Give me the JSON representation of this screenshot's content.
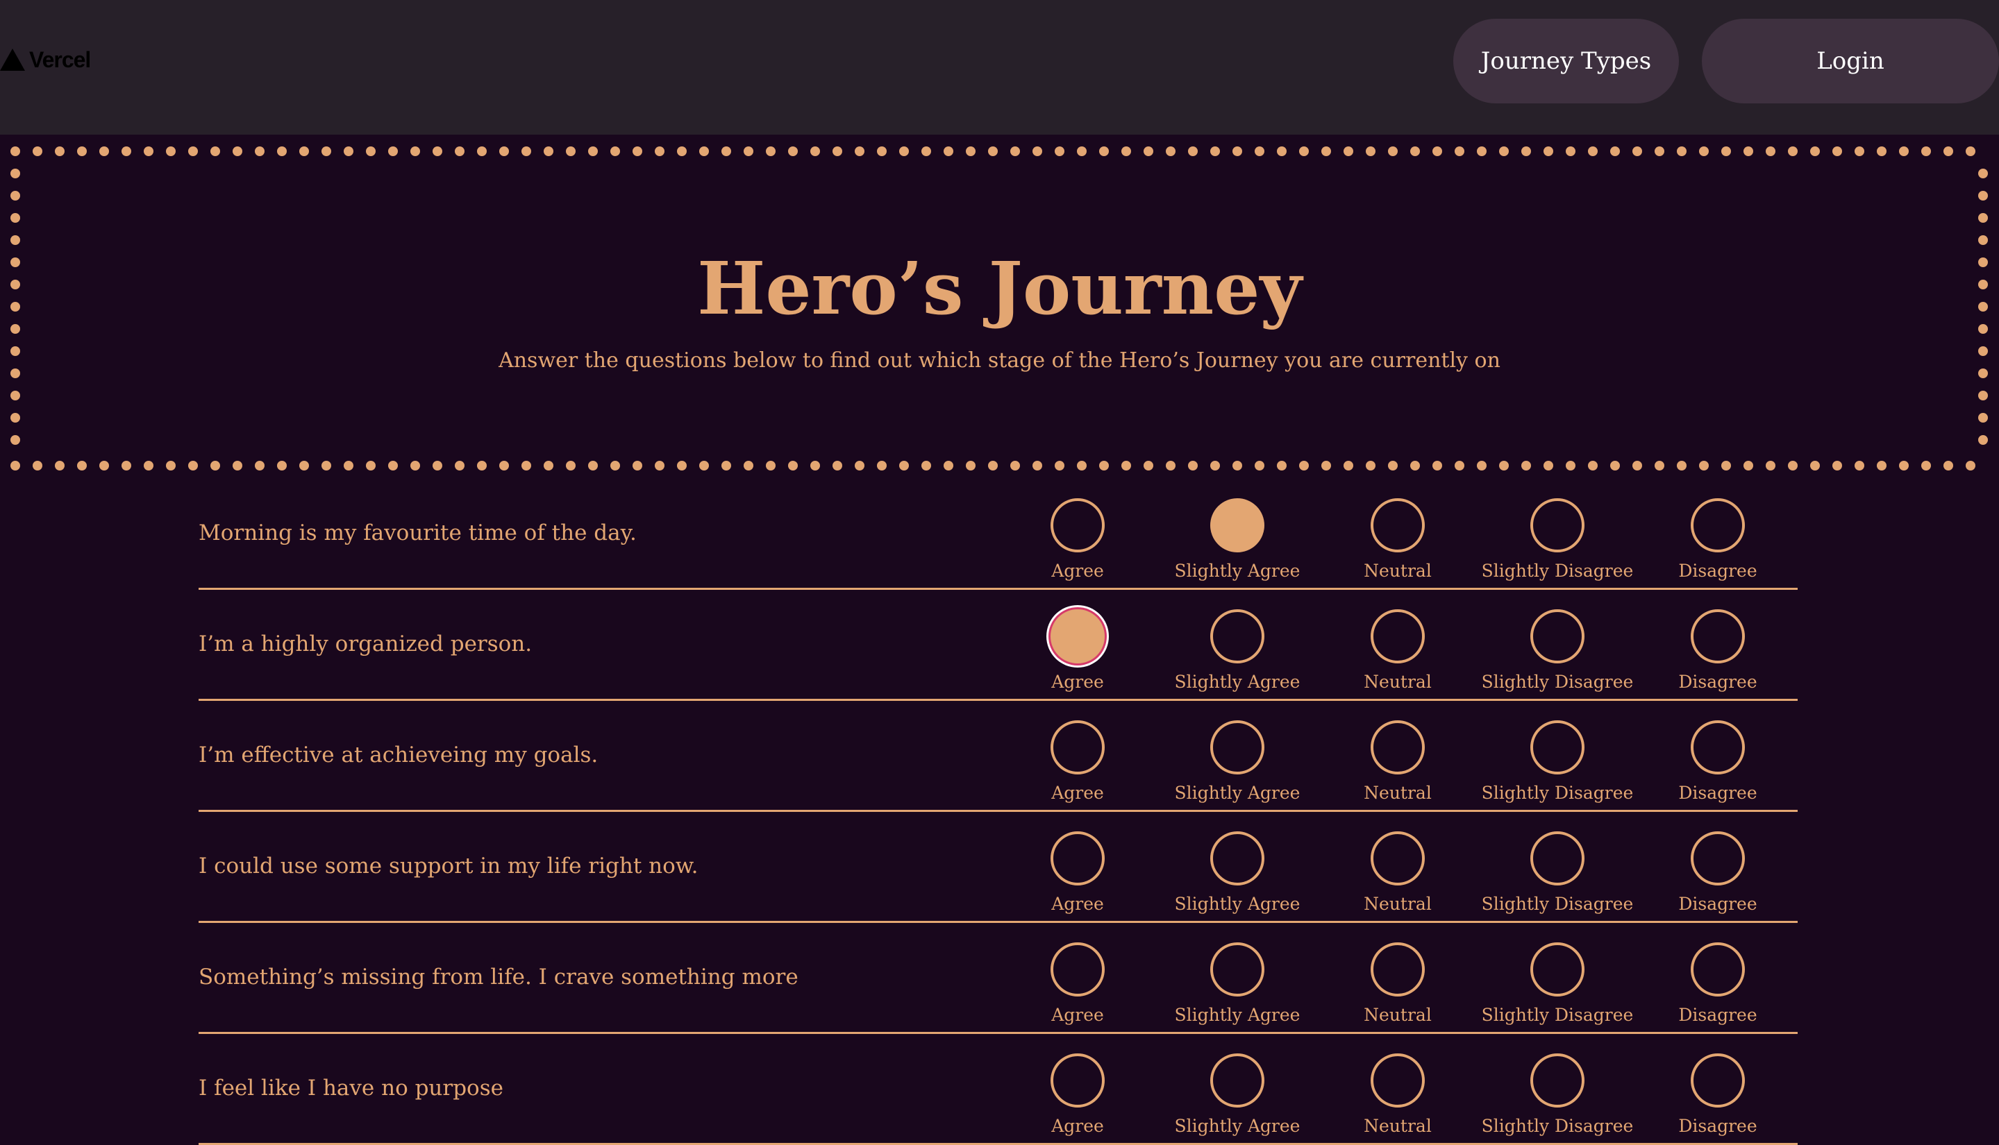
{
  "header": {
    "logo_text": "Vercel",
    "logo_icon": "triangle-icon",
    "nav": [
      {
        "label": "Journey Types"
      },
      {
        "label": "Login"
      }
    ]
  },
  "hero": {
    "title": "Hero’s Journey",
    "subtitle": "Answer the questions below to find out which stage of the Hero’s Journey you are currently on"
  },
  "options": [
    "Agree",
    "Slightly Agree",
    "Neutral",
    "Slightly Disagree",
    "Disagree"
  ],
  "questions": [
    {
      "text": "Morning is my favourite time of the day.",
      "selected": "Slightly Agree"
    },
    {
      "text": "I’m a highly organized person.",
      "selected": "Agree",
      "focused": true
    },
    {
      "text": "I’m effective at achieveing my goals.",
      "selected": null
    },
    {
      "text": "I could use some support in my life right now.",
      "selected": null
    },
    {
      "text": "Something’s missing from life. I crave something more",
      "selected": null
    },
    {
      "text": "I feel like I have no purpose",
      "selected": null
    }
  ],
  "colors": {
    "background": "#19071d",
    "topbar": "#272029",
    "nav_button": "#3e303f",
    "accent": "#e3a672",
    "focus_ring": "#d63a6a"
  }
}
